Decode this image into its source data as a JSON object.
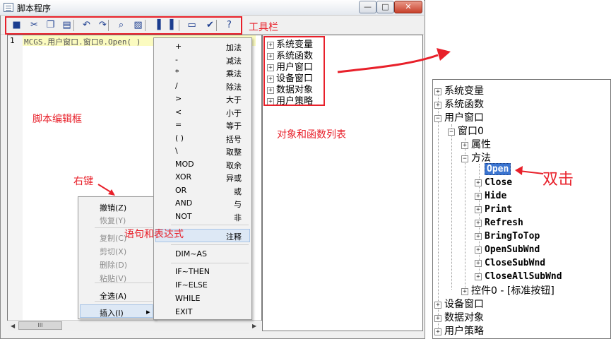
{
  "window": {
    "title": "脚本程序",
    "controls": {
      "minimize": "—",
      "maximize": "□",
      "close": "✕"
    }
  },
  "toolbar": {
    "items": [
      {
        "name": "save-icon",
        "glyph": "■"
      },
      {
        "name": "cut-icon",
        "glyph": "✂"
      },
      {
        "name": "copy-icon",
        "glyph": "❐"
      },
      {
        "name": "paste-icon",
        "glyph": "▤"
      },
      {
        "name": "undo-icon",
        "glyph": "↶"
      },
      {
        "name": "redo-icon",
        "glyph": "↷"
      },
      {
        "name": "find-icon",
        "glyph": "⌕"
      },
      {
        "name": "replace-icon",
        "glyph": "▧"
      },
      {
        "name": "import-icon",
        "glyph": "▐"
      },
      {
        "name": "export-icon",
        "glyph": "▌"
      },
      {
        "name": "comment-icon",
        "glyph": "▭"
      },
      {
        "name": "check-icon",
        "glyph": "✔"
      },
      {
        "name": "help-icon",
        "glyph": "?"
      }
    ]
  },
  "editor": {
    "line_number": "1",
    "code": "MCGS.用户窗口.窗口0.Open( )",
    "scroll_thumb": "III"
  },
  "tree": {
    "items": [
      "系统变量",
      "系统函数",
      "用户窗口",
      "设备窗口",
      "数据对象",
      "用户策略"
    ],
    "expander": "+"
  },
  "context_menu": {
    "items": [
      {
        "label": "撤销(Z)",
        "enabled": true
      },
      {
        "label": "恢复(Y)",
        "enabled": false
      },
      {
        "label": "复制(C)",
        "enabled": false
      },
      {
        "label": "剪切(X)",
        "enabled": false
      },
      {
        "label": "删除(D)",
        "enabled": false
      },
      {
        "label": "粘贴(V)",
        "enabled": false
      },
      {
        "label": "全选(A)",
        "enabled": true
      },
      {
        "label": "插入(I)",
        "enabled": true,
        "submenu_arrow": "▸"
      }
    ]
  },
  "insert_menu": {
    "operators": [
      {
        "symbol": "+",
        "desc": "加法"
      },
      {
        "symbol": "-",
        "desc": "减法"
      },
      {
        "symbol": "*",
        "desc": "乘法"
      },
      {
        "symbol": "/",
        "desc": "除法"
      },
      {
        "symbol": ">",
        "desc": "大于"
      },
      {
        "symbol": "<",
        "desc": "小于"
      },
      {
        "symbol": "=",
        "desc": "等于"
      },
      {
        "symbol": "( )",
        "desc": "括号"
      },
      {
        "symbol": "\\",
        "desc": "取整"
      },
      {
        "symbol": "MOD",
        "desc": "取余"
      },
      {
        "symbol": "XOR",
        "desc": "异或"
      },
      {
        "symbol": "OR",
        "desc": "或"
      },
      {
        "symbol": "AND",
        "desc": "与"
      },
      {
        "symbol": "NOT",
        "desc": "非"
      }
    ],
    "comment": "注释",
    "statements": [
      "DIM~AS",
      "IF~THEN",
      "IF~ELSE",
      "WHILE",
      "EXIT"
    ]
  },
  "annotations": {
    "toolbar": "工具栏",
    "editor": "脚本编辑框",
    "right_click": "右键",
    "statements": "语句和表达式",
    "object_list": "对象和函数列表",
    "double_click": "双击"
  },
  "zoom_tree": {
    "root_top": [
      "系统变量",
      "系统函数",
      "用户窗口"
    ],
    "window0": "窗口0",
    "props": "属性",
    "methods": "方法",
    "open": "Open",
    "method_list": [
      "Close",
      "Hide",
      "Print",
      "Refresh",
      "BringToTop",
      "OpenSubWnd",
      "CloseSubWnd",
      "CloseAllSubWnd"
    ],
    "control": "控件0 - [标准按钮]",
    "root_bottom": [
      "设备窗口",
      "数据对象",
      "用户策略"
    ]
  },
  "colors": {
    "annotation": "#e8202a",
    "selection": "#3a74d0",
    "current_line": "#fbfbc0"
  }
}
